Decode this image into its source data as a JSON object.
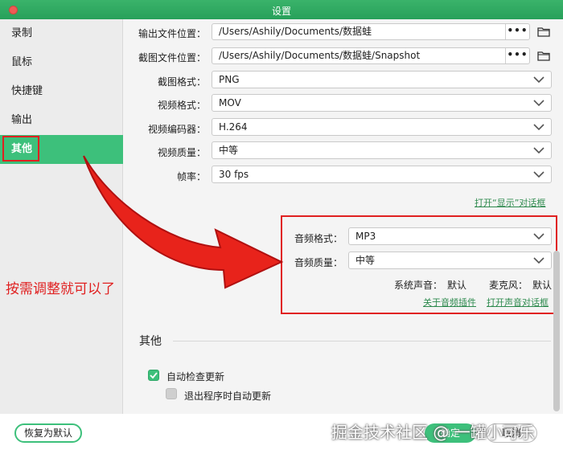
{
  "window": {
    "title": "设置"
  },
  "sidebar": {
    "items": [
      {
        "label": "录制"
      },
      {
        "label": "鼠标"
      },
      {
        "label": "快捷键"
      },
      {
        "label": "输出"
      },
      {
        "label": "其他",
        "active": true
      }
    ]
  },
  "settings": {
    "output_location": {
      "label": "输出文件位置：",
      "value": "/Users/Ashily/Documents/数据蛙",
      "browse": "•••"
    },
    "screenshot_location": {
      "label": "截图文件位置：",
      "value": "/Users/Ashily/Documents/数据蛙/Snapshot",
      "browse": "•••"
    },
    "screenshot_format": {
      "label": "截图格式：",
      "value": "PNG"
    },
    "video_format": {
      "label": "视频格式：",
      "value": "MOV"
    },
    "video_encoder": {
      "label": "视频编码器：",
      "value": "H.264"
    },
    "video_quality": {
      "label": "视频质量：",
      "value": "中等"
    },
    "frame_rate": {
      "label": "帧率：",
      "value": "30 fps"
    },
    "display_dialog_link": "打开“显示”对话框"
  },
  "audio": {
    "audio_format": {
      "label": "音频格式：",
      "value": "MP3"
    },
    "audio_quality": {
      "label": "音频质量：",
      "value": "中等"
    },
    "system_sound": {
      "label": "系统声音：",
      "value": "默认"
    },
    "microphone": {
      "label": "麦克风：",
      "value": "默认"
    },
    "about_plugin_link": "关于音频插件",
    "sound_dialog_link": "打开声音对话框"
  },
  "other": {
    "title": "其他",
    "auto_check_update": {
      "label": "自动检查更新",
      "checked": true
    },
    "auto_update_on_exit": {
      "label": "退出程序时自动更新",
      "checked": false
    }
  },
  "footer": {
    "reset_label": "恢复为默认",
    "ok_label": "确定",
    "cancel_label": "取消"
  },
  "annotation": {
    "text": "按需调整就可以了"
  },
  "watermark": {
    "text": "掘金技术社区 @ 一罐小可乐"
  },
  "colors": {
    "accent": "#3dc07b",
    "highlight_red": "#e02020",
    "link": "#2e8a4e"
  }
}
